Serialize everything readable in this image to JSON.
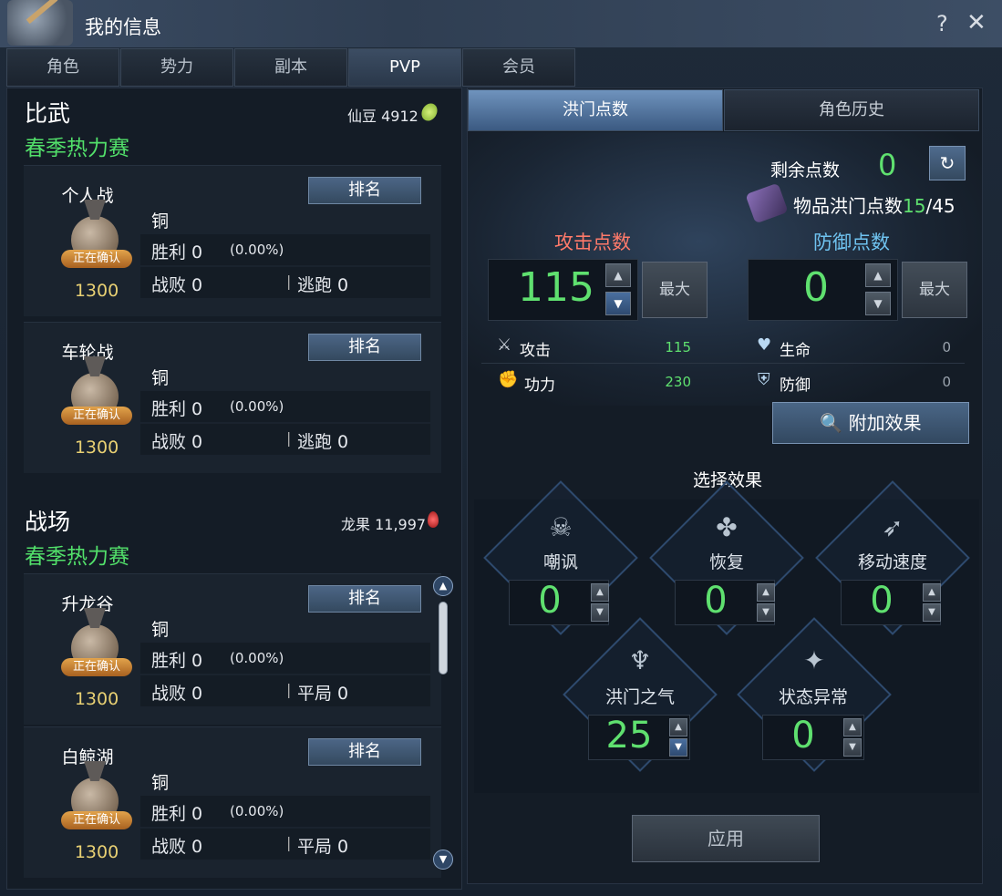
{
  "window": {
    "title": "我的信息",
    "help": "?",
    "close": "✕"
  },
  "tabs": [
    {
      "label": "角色"
    },
    {
      "label": "势力"
    },
    {
      "label": "副本"
    },
    {
      "label": "PVP"
    },
    {
      "label": "会员"
    }
  ],
  "biwu": {
    "title": "比武",
    "season": "春季热力赛",
    "currency_label": "仙豆 4912",
    "cards": [
      {
        "name": "个人战",
        "rank_button": "排名",
        "tier": "铜",
        "badge": "正在确认",
        "score": "1300",
        "win_label": "胜利 0",
        "win_pct": "(0.00%)",
        "loss_label": "战败 0",
        "sep": "|",
        "extra_label": "逃跑 0"
      },
      {
        "name": "车轮战",
        "rank_button": "排名",
        "tier": "铜",
        "badge": "正在确认",
        "score": "1300",
        "win_label": "胜利 0",
        "win_pct": "(0.00%)",
        "loss_label": "战败 0",
        "sep": "|",
        "extra_label": "逃跑 0"
      }
    ]
  },
  "battlefield": {
    "title": "战场",
    "season": "春季热力赛",
    "currency_label": "龙果 11,997",
    "cards": [
      {
        "name": "升龙谷",
        "rank_button": "排名",
        "tier": "铜",
        "badge": "正在确认",
        "score": "1300",
        "win_label": "胜利 0",
        "win_pct": "(0.00%)",
        "loss_label": "战败 0",
        "sep": "|",
        "extra_label": "平局 0"
      },
      {
        "name": "白鲸湖",
        "rank_button": "排名",
        "tier": "铜",
        "badge": "正在确认",
        "score": "1300",
        "win_label": "胜利 0",
        "win_pct": "(0.00%)",
        "loss_label": "战败 0",
        "sep": "|",
        "extra_label": "平局 0"
      }
    ]
  },
  "right": {
    "tabs": [
      "洪门点数",
      "角色历史"
    ],
    "remaining_label": "剩余点数",
    "remaining_value": "0",
    "item_points_label": "物品洪门点数",
    "item_points_current": "15",
    "item_points_total": "/45",
    "attack_title": "攻击点数",
    "defense_title": "防御点数",
    "attack_value": "115",
    "defense_value": "0",
    "max_label": "最大",
    "stats": {
      "attack_label": "攻击",
      "attack_value": "115",
      "power_label": "功力",
      "power_value": "230",
      "life_label": "生命",
      "life_value": "0",
      "defense_label": "防御",
      "defense_value": "0"
    },
    "addon_button": "附加效果",
    "select_title": "选择效果",
    "effects": [
      {
        "label": "嘲讽",
        "value": "0"
      },
      {
        "label": "恢复",
        "value": "0"
      },
      {
        "label": "移动速度",
        "value": "0"
      },
      {
        "label": "洪门之气",
        "value": "25"
      },
      {
        "label": "状态异常",
        "value": "0"
      }
    ],
    "apply_button": "应用"
  },
  "colors": {
    "green": "#5fe06f",
    "attack_title": "#ff7a6a",
    "defense_title": "#6fc3f0",
    "season": "#52e06a"
  }
}
